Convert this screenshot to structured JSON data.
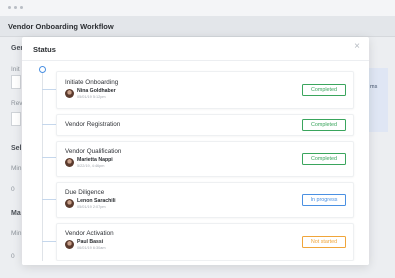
{
  "page": {
    "title": "Vendor Onboarding Workflow",
    "bg_labels": [
      "Gen",
      "Init",
      "Rev",
      "Sel",
      "Min",
      "0",
      "Ma",
      "Min",
      "0"
    ],
    "bg_side_text": "ms"
  },
  "modal": {
    "title": "Status",
    "close_glyph": "×"
  },
  "steps": [
    {
      "title": "Initiate Onboarding",
      "user": "Nina Goldhaber",
      "date": "05/01/19 5:12pm",
      "status": "Completed",
      "status_color": "#3aa55d"
    },
    {
      "title": "Vendor Registration",
      "user": "",
      "date": "",
      "status": "Completed",
      "status_color": "#3aa55d"
    },
    {
      "title": "Vendor Qualification",
      "user": "Marietta Nappi",
      "date": "5/22/19, 4:46pm",
      "status": "Completed",
      "status_color": "#3aa55d"
    },
    {
      "title": "Due Diligence",
      "user": "Lenon Sarachili",
      "date": "05/01/19 2:07pm",
      "status": "In progress",
      "status_color": "#4a90e2"
    },
    {
      "title": "Vendor Activation",
      "user": "Paul Bassi",
      "date": "06/01/19 6:30am",
      "status": "Not started",
      "status_color": "#f0a53a"
    }
  ],
  "colors": {
    "completed": "#3aa55d",
    "in_progress": "#4a90e2",
    "not_started": "#f0a53a",
    "timeline_dot": "#4a90e2"
  }
}
